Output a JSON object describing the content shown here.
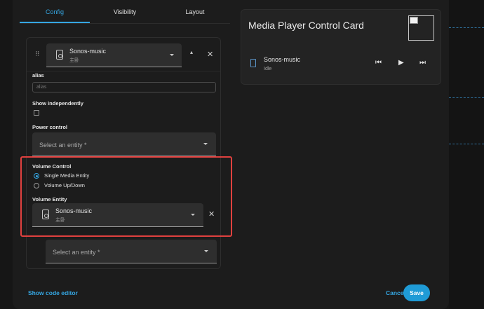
{
  "tabs": [
    {
      "label": "Config"
    },
    {
      "label": "Visibility"
    },
    {
      "label": "Layout"
    }
  ],
  "entity_row": {
    "name": "Sonos-music",
    "sub": "主卧"
  },
  "alias": {
    "label": "alias",
    "placeholder": "alias"
  },
  "show_independently": {
    "label": "Show independently"
  },
  "power_control": {
    "label": "Power control",
    "placeholder": "Select an entity *"
  },
  "volume_control": {
    "label": "Volume Control",
    "options": [
      {
        "label": "Single Media Entity",
        "selected": true
      },
      {
        "label": "Volume Up/Down",
        "selected": false
      }
    ]
  },
  "volume_entity": {
    "label": "Volume Entity",
    "name": "Sonos-music",
    "sub": "主卧"
  },
  "extra_entity": {
    "placeholder": "Select an entity *"
  },
  "preview": {
    "title": "Media Player Control Card",
    "player_name": "Sonos-music",
    "player_state": "Idle"
  },
  "footer": {
    "code_editor": "Show code editor",
    "cancel": "Cancel",
    "save": "Save"
  },
  "colors": {
    "accent": "#35a7e3",
    "highlight": "#e0413f",
    "save_bg": "#1f9bd6"
  }
}
